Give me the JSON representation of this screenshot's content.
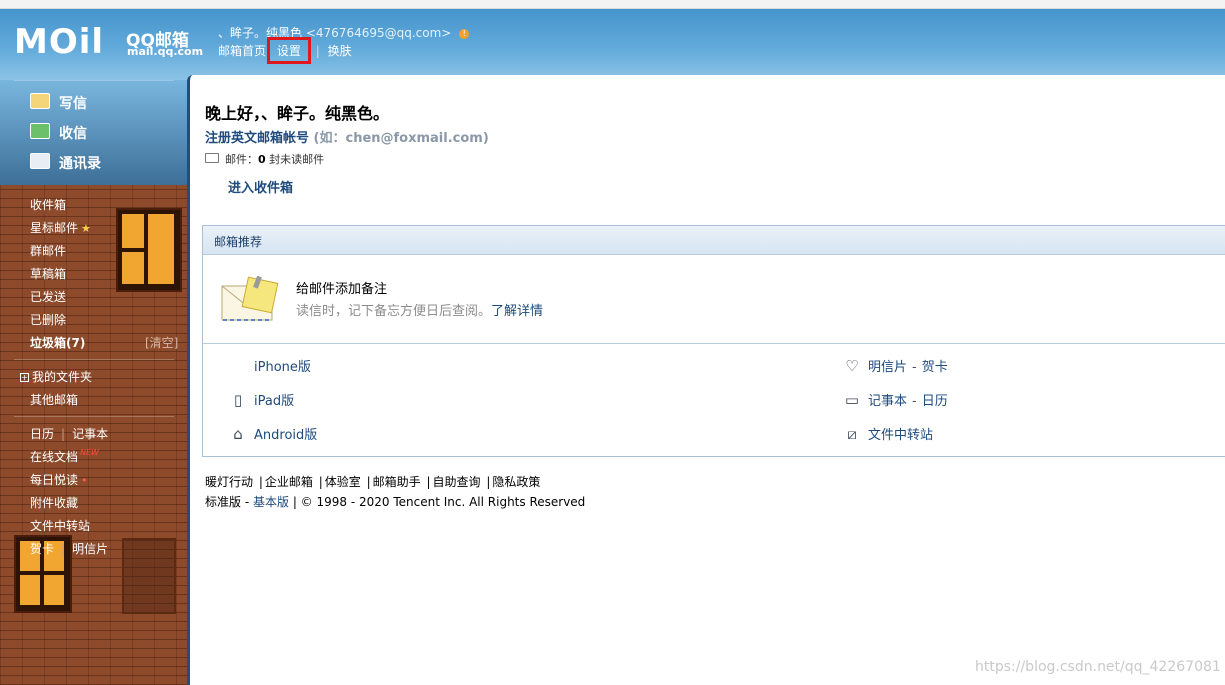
{
  "header": {
    "logo_text": "MOil",
    "brand": "QQ邮箱",
    "brand_domain": "mail.qq.com",
    "account_name": "、眸子。纯黑色",
    "account_email": "<476764695@qq.com>",
    "nav": [
      {
        "label": "邮箱首页"
      },
      {
        "label": "设置",
        "active": true
      },
      {
        "label": "换肤"
      }
    ]
  },
  "sidebar": {
    "commands": [
      {
        "label": "写信",
        "icon": "compose-icon"
      },
      {
        "label": "收信",
        "icon": "receive-icon"
      },
      {
        "label": "通讯录",
        "icon": "contacts-icon"
      }
    ],
    "folders": {
      "inbox": "收件箱",
      "starred": "星标邮件",
      "group": "群邮件",
      "drafts": "草稿箱",
      "sent": "已发送",
      "deleted": "已删除",
      "spam": "垃圾箱(7)",
      "spam_clear": "[清空]",
      "my_folders": "我的文件夹",
      "other_mailbox": "其他邮箱"
    },
    "apps": {
      "calendar": "日历",
      "notepad": "记事本",
      "online_docs": "在线文档",
      "new_badge": "NEW",
      "daily_reading": "每日悦读",
      "attachments": "附件收藏",
      "file_transfer": "文件中转站",
      "greeting_card": "贺卡",
      "postcard": "明信片"
    }
  },
  "main": {
    "greeting": "晚上好，、眸子。纯黑色。",
    "register_link": "注册英文邮箱帐号",
    "register_hint": "(如：chen@foxmail.com)",
    "mail_label": "邮件：",
    "mail_count": "0",
    "unread_text": "封未读邮件",
    "enter_inbox": "进入收件箱"
  },
  "recommend": {
    "title": "邮箱推荐",
    "tip_title": "给邮件添加备注",
    "tip_desc": "读信时，记下备忘方便日后查阅。",
    "tip_link": "了解详情",
    "devices_left": [
      {
        "label": "iPhone版",
        "icon": "apple-icon"
      },
      {
        "label": "iPad版",
        "icon": "ipad-icon"
      },
      {
        "label": "Android版",
        "icon": "android-icon"
      }
    ],
    "devices_right": [
      {
        "a": "明信片",
        "b": "贺卡",
        "icon": "heart-icon"
      },
      {
        "a": "记事本",
        "b": "日历",
        "icon": "calendar-icon"
      },
      {
        "a": "文件中转站",
        "b": "",
        "icon": "transfer-icon"
      }
    ]
  },
  "footer": {
    "links": [
      "暖灯行动",
      "企业邮箱",
      "体验室",
      "邮箱助手",
      "自助查询",
      "隐私政策"
    ],
    "edition_std": "标准版",
    "edition_basic": "基本版",
    "copyright": "© 1998 - 2020 Tencent Inc. All Rights Reserved"
  },
  "watermark": "https://blog.csdn.net/qq_42267081",
  "colors": {
    "accent": "#1e4a7d",
    "highlight_box": "#e0171c",
    "header_blue": "#3f8fc9",
    "brick": "#8d4b2c"
  }
}
